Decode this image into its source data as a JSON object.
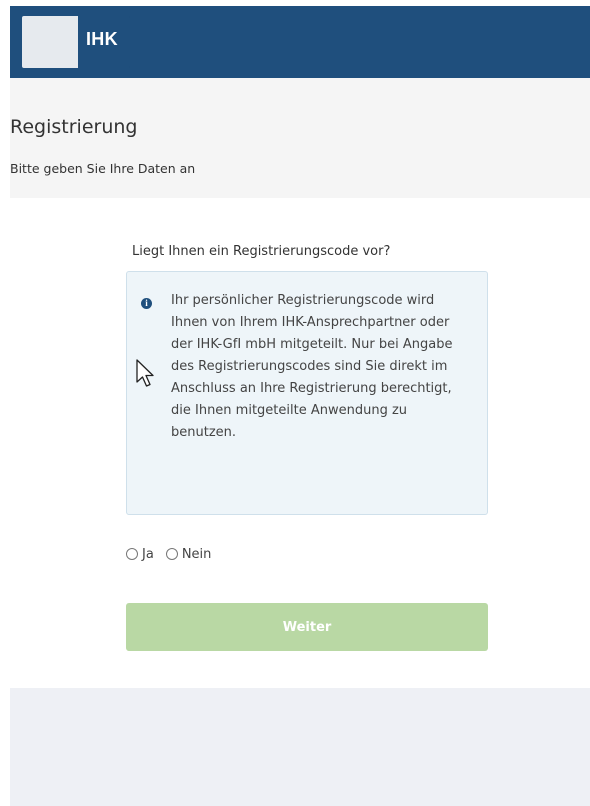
{
  "header": {
    "logo_text": "IHK",
    "background_color": "#1f4f7d"
  },
  "page": {
    "title": "Registrierung",
    "subtitle": "Bitte geben Sie Ihre Daten an"
  },
  "form": {
    "question": "Liegt Ihnen ein Registrierungscode vor?",
    "info_icon": "info-circle-icon",
    "info_text": "Ihr persönlicher Registrierungscode wird Ihnen von Ihrem IHK-Ansprechpartner oder der IHK-GfI mbH mitgeteilt. Nur bei Angabe des Registrierungscodes sind Sie direkt im Anschluss an Ihre Registrierung berechtigt, die Ihnen mitgeteilte Anwendung zu benutzen.",
    "options": [
      {
        "label": "Ja",
        "selected": false
      },
      {
        "label": "Nein",
        "selected": false
      }
    ],
    "submit_label": "Weiter",
    "submit_color": "#b9d8a4"
  }
}
